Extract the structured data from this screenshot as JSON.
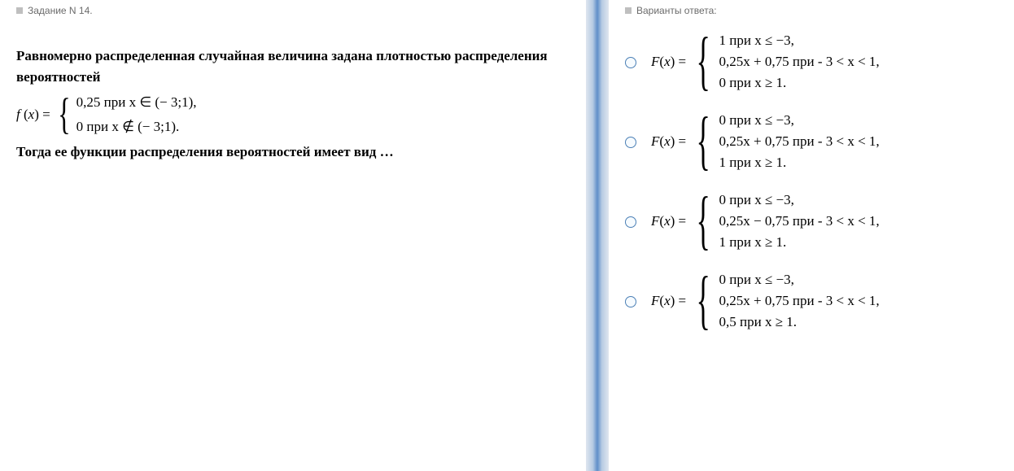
{
  "left": {
    "header": "Задание N 14.",
    "p1": "Равномерно распределенная случайная величина задана плотностью распределения вероятностей",
    "fx_lhs": "f (x) =",
    "fx_case1": "0,25  при   x ∈ (− 3;1),",
    "fx_case2": "0    при   x ∉ (− 3;1).",
    "p2": "Тогда ее функции распределения вероятностей имеет вид …"
  },
  "right": {
    "header": "Варианты ответа:",
    "lhs": "F (x) =",
    "answers": [
      {
        "l1": "1  при   x ≤ −3,",
        "l2": "0,25x + 0,75   при  - 3 < x < 1,",
        "l3": "0   при   x ≥ 1."
      },
      {
        "l1": "0  при   x ≤ −3,",
        "l2": "0,25x + 0,75   при  - 3 < x < 1,",
        "l3": "1   при   x ≥ 1."
      },
      {
        "l1": "0  при   x ≤ −3,",
        "l2": "0,25x − 0,75   при  - 3 < x < 1,",
        "l3": "1   при   x ≥ 1."
      },
      {
        "l1": "0  при   x ≤ −3,",
        "l2": "0,25x + 0,75   при  - 3 < x < 1,",
        "l3": "0,5   при   x ≥ 1."
      }
    ]
  }
}
